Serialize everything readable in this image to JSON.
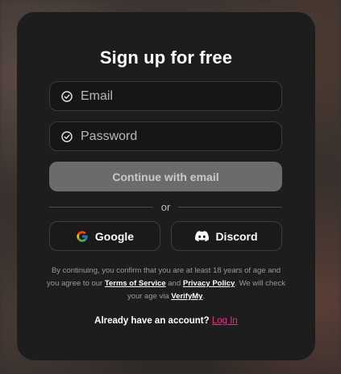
{
  "form": {
    "title": "Sign up for free",
    "email_placeholder": "Email",
    "password_placeholder": "Password",
    "continue_label": "Continue with email",
    "divider_text": "or"
  },
  "social": {
    "google_label": "Google",
    "discord_label": "Discord",
    "google_icon": "google-logo-icon",
    "discord_icon": "discord-logo-icon"
  },
  "legal": {
    "text_1": "By continuing, you confirm that you are at least 18 years of age and you agree to our ",
    "terms_link": "Terms of Service",
    "text_2": " and ",
    "privacy_link": "Privacy Policy",
    "text_3": ". We will check your age via ",
    "verify_link": "VerifyMy",
    "text_4": "."
  },
  "footer": {
    "prompt": "Already have an account? ",
    "login_link": "Log In"
  },
  "colors": {
    "card_bg": "#1d1d1d",
    "accent_link": "#e0368a",
    "continue_disabled_bg": "#6b6b6b"
  }
}
